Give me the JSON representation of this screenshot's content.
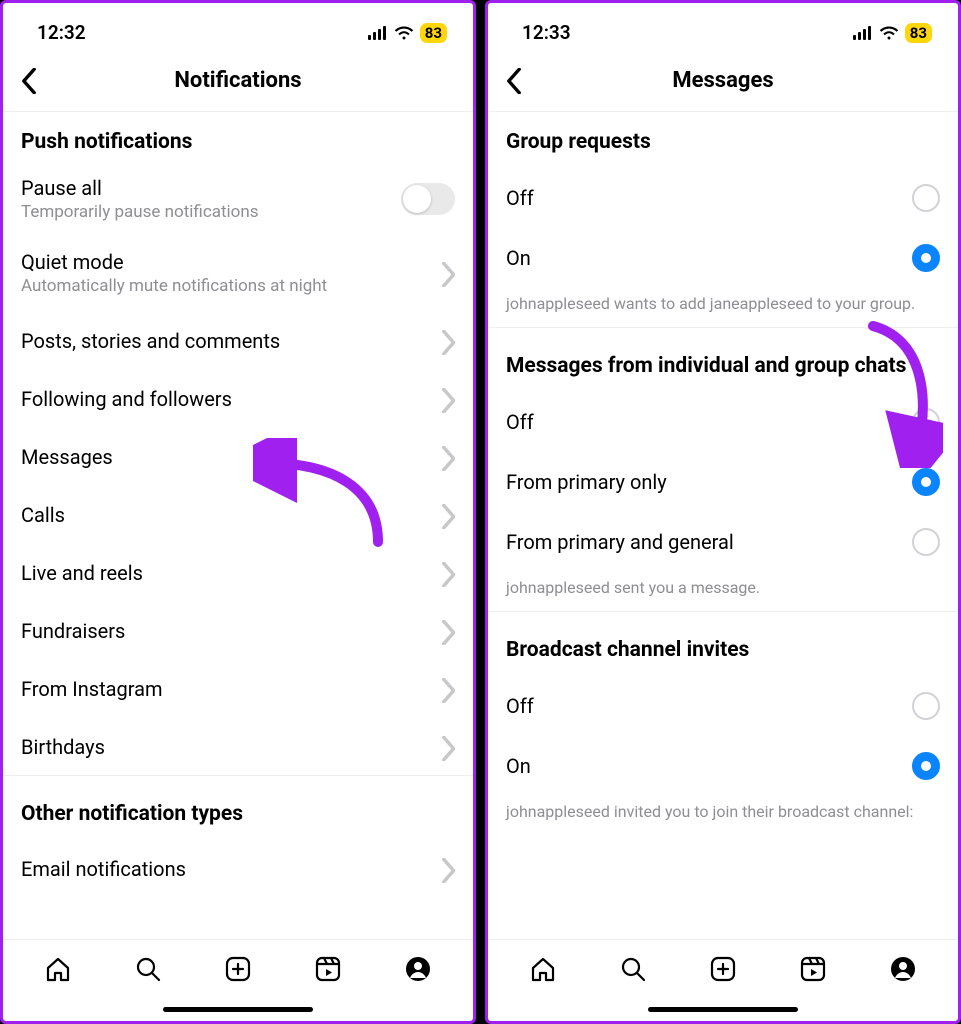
{
  "left": {
    "status": {
      "time": "12:32",
      "battery": "83"
    },
    "nav_title": "Notifications",
    "section1_title": "Push notifications",
    "pause_all": {
      "label": "Pause all",
      "sublabel": "Temporarily pause notifications"
    },
    "quiet_mode": {
      "label": "Quiet mode",
      "sublabel": "Automatically mute notifications at night"
    },
    "items": [
      {
        "label": "Posts, stories and comments"
      },
      {
        "label": "Following and followers"
      },
      {
        "label": "Messages"
      },
      {
        "label": "Calls"
      },
      {
        "label": "Live and reels"
      },
      {
        "label": "Fundraisers"
      },
      {
        "label": "From Instagram"
      },
      {
        "label": "Birthdays"
      }
    ],
    "section2_title": "Other notification types",
    "other_items": [
      {
        "label": "Email notifications"
      }
    ]
  },
  "right": {
    "status": {
      "time": "12:33",
      "battery": "83"
    },
    "nav_title": "Messages",
    "groups": {
      "group_requests": {
        "title": "Group requests",
        "off": "Off",
        "on": "On",
        "footer": "johnappleseed wants to add janeappleseed to your group.",
        "selected": "on"
      },
      "messages_chats": {
        "title": "Messages from individual and group chats",
        "off": "Off",
        "primary": "From primary only",
        "primary_general": "From primary and general",
        "footer": "johnappleseed sent you a message.",
        "selected": "primary"
      },
      "broadcast": {
        "title": "Broadcast channel invites",
        "off": "Off",
        "on": "On",
        "footer": "johnappleseed invited you to join their broadcast channel:",
        "selected": "on"
      }
    }
  },
  "colors": {
    "accent": "#0a84ff",
    "annotation": "#a020f0",
    "battery_bg": "#ffd60a"
  }
}
